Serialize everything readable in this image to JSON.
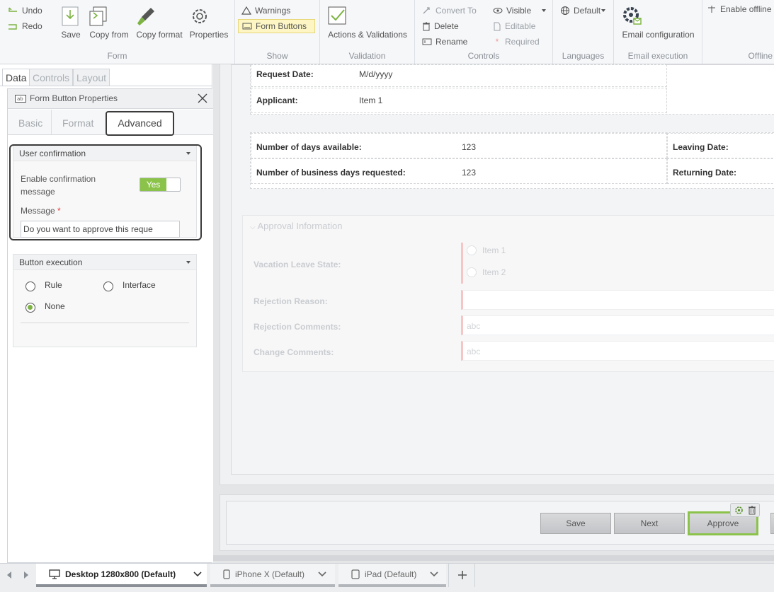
{
  "ribbon": {
    "undo": "Undo",
    "redo": "Redo",
    "save": "Save",
    "copy_from": "Copy from",
    "copy_format": "Copy format",
    "properties": "Properties",
    "group_form": "Form",
    "warnings": "Warnings",
    "form_buttons": "Form Buttons",
    "group_show": "Show",
    "actions_validations": "Actions & Validations",
    "group_validation": "Validation",
    "convert_to": "Convert To",
    "delete": "Delete",
    "rename": "Rename",
    "visible": "Visible",
    "editable": "Editable",
    "required": "Required",
    "group_controls": "Controls",
    "default_lang": "Default",
    "group_languages": "Languages",
    "email_configuration": "Email configuration",
    "group_email": "Email execution",
    "enable_offline": "Enable offline",
    "group_offline": "Offline"
  },
  "left_tabs": [
    "Data",
    "Controls",
    "Layout"
  ],
  "props": {
    "title": "Form Button Properties",
    "tabs": [
      "Basic",
      "Format",
      "Advanced"
    ],
    "user_confirmation": {
      "header": "User confirmation",
      "enable_label": "Enable confirmation message",
      "toggle": "Yes",
      "message_label": "Message",
      "required_mark": "*",
      "message_value": "Do you want to approve this reque"
    },
    "button_execution": {
      "header": "Button execution",
      "options": [
        "Rule",
        "Interface",
        "None"
      ],
      "selected": "None"
    }
  },
  "form": {
    "request_date_label": "Request Date:",
    "request_date_value": "M/d/yyyy",
    "applicant_label": "Applicant:",
    "applicant_value": "Item 1",
    "days_available_label": "Number of days available:",
    "days_available_value": "123",
    "business_days_label": "Number of business days requested:",
    "business_days_value": "123",
    "leaving_date_label": "Leaving Date:",
    "returning_date_label": "Returning Date:",
    "approval_header": "Approval Information",
    "vacation_state_label": "Vacation Leave State:",
    "vacation_items": [
      "Item 1",
      "Item 2"
    ],
    "rejection_reason_label": "Rejection Reason:",
    "rejection_comments_label": "Rejection Comments:",
    "rejection_comments_placeholder": "abc",
    "change_comments_label": "Change Comments:",
    "change_comments_placeholder": "abc"
  },
  "form_buttons": [
    "Save",
    "Next",
    "Approve"
  ],
  "devices": [
    {
      "label": "Desktop 1280x800 (Default)",
      "active": true
    },
    {
      "label": "iPhone X (Default)",
      "active": false
    },
    {
      "label": "iPad (Default)",
      "active": false
    }
  ],
  "colors": {
    "accent": "#8bc34a",
    "toggle": "#8bc34a",
    "required": "#e53935"
  }
}
